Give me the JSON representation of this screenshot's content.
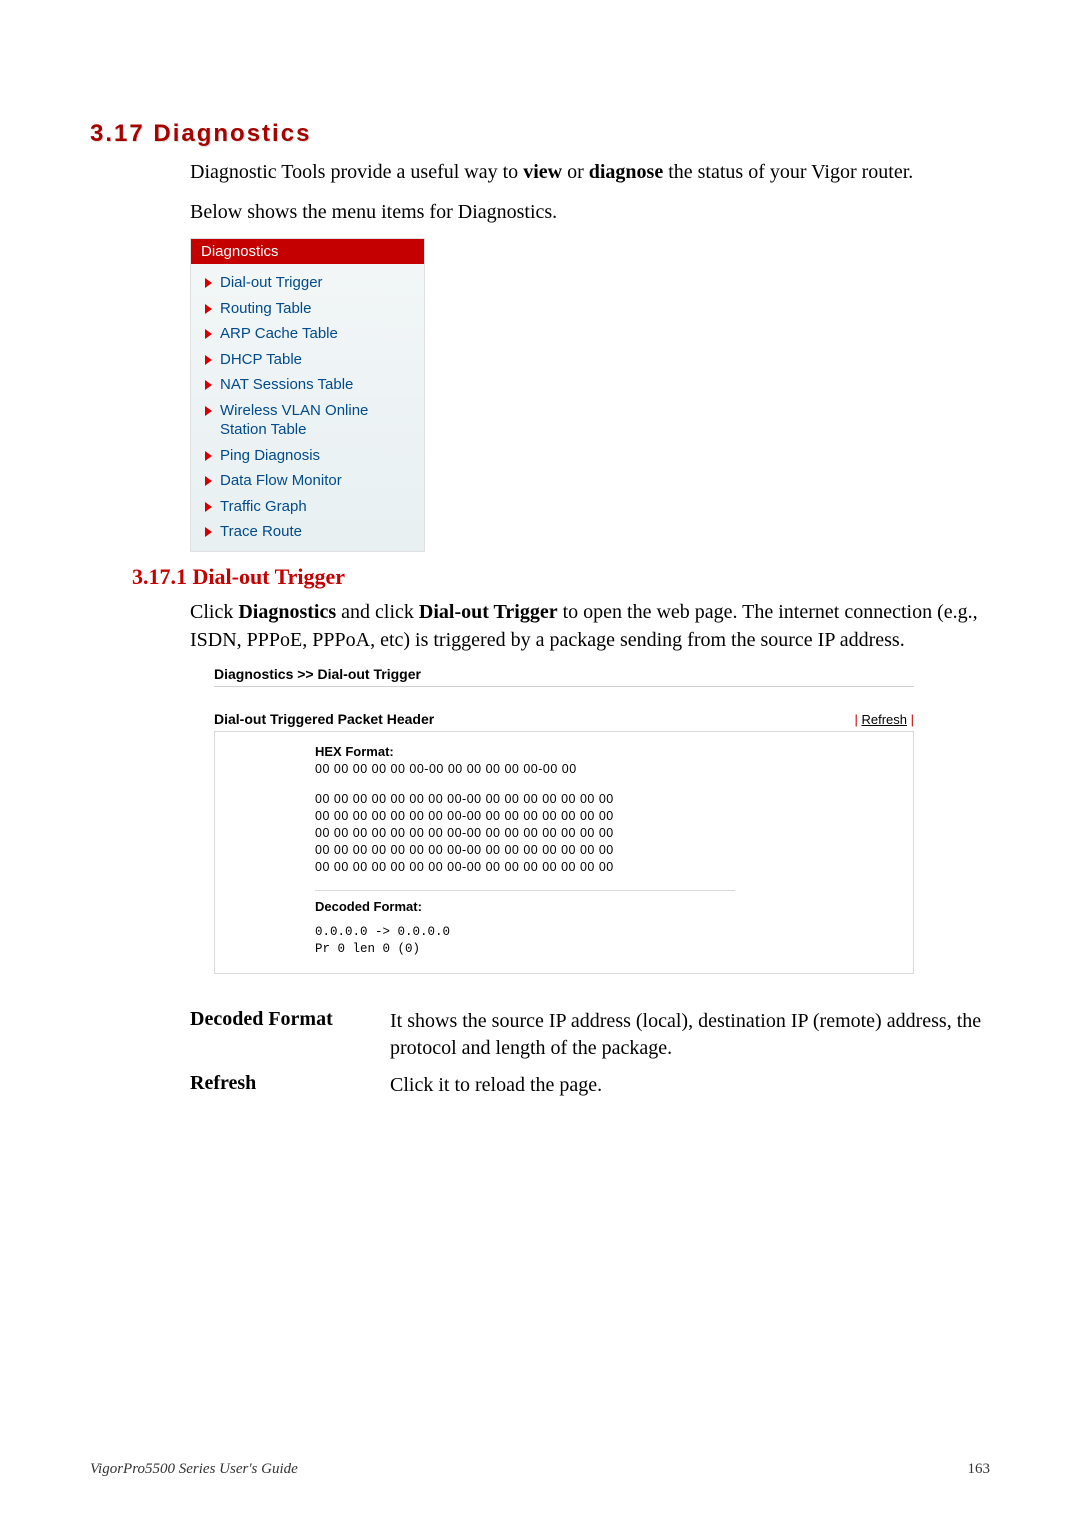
{
  "heading": "3.17 Diagnostics",
  "intro1_a": "Diagnostic Tools provide a useful way to ",
  "intro1_b": "view",
  "intro1_c": " or ",
  "intro1_d": "diagnose",
  "intro1_e": " the status of your Vigor router.",
  "intro2": "Below shows the menu items for Diagnostics.",
  "diag": {
    "title": "Diagnostics",
    "items": [
      "Dial-out Trigger",
      "Routing Table",
      "ARP Cache Table",
      "DHCP Table",
      "NAT Sessions Table",
      "Wireless VLAN Online Station Table",
      "Ping Diagnosis",
      "Data Flow Monitor",
      "Traffic Graph",
      "Trace Route"
    ]
  },
  "sub1": "3.17.1 Dial-out Trigger",
  "sub1_body_a": "Click ",
  "sub1_body_b": "Diagnostics",
  "sub1_body_c": " and click ",
  "sub1_body_d": "Dial-out Trigger",
  "sub1_body_e": " to open the web page. The internet connection (e.g., ISDN, PPPoE, PPPoA, etc) is triggered by a package sending from the source IP address.",
  "panel": {
    "breadcrumb": "Diagnostics >> Dial-out Trigger",
    "title": "Dial-out Triggered Packet Header",
    "refresh_sep_l": "| ",
    "refresh": "Refresh",
    "refresh_sep_r": " |",
    "hex_label": "HEX Format:",
    "hex1": "00 00 00 00 00 00-00 00 00 00 00 00-00 00",
    "hex2": "00 00 00 00 00 00 00 00-00 00 00 00 00 00 00 00\n00 00 00 00 00 00 00 00-00 00 00 00 00 00 00 00\n00 00 00 00 00 00 00 00-00 00 00 00 00 00 00 00\n00 00 00 00 00 00 00 00-00 00 00 00 00 00 00 00\n00 00 00 00 00 00 00 00-00 00 00 00 00 00 00 00",
    "dec_label": "Decoded Format:",
    "decoded": "0.0.0.0 -> 0.0.0.0\nPr 0 len 0 (0)"
  },
  "defs": [
    {
      "term": "Decoded Format",
      "desc": "It shows the source IP address (local), destination IP (remote) address, the protocol and length of the package."
    },
    {
      "term": "Refresh",
      "desc": "Click it to reload the page."
    }
  ],
  "footer": {
    "left": "VigorPro5500 Series User's Guide",
    "right": "163"
  }
}
